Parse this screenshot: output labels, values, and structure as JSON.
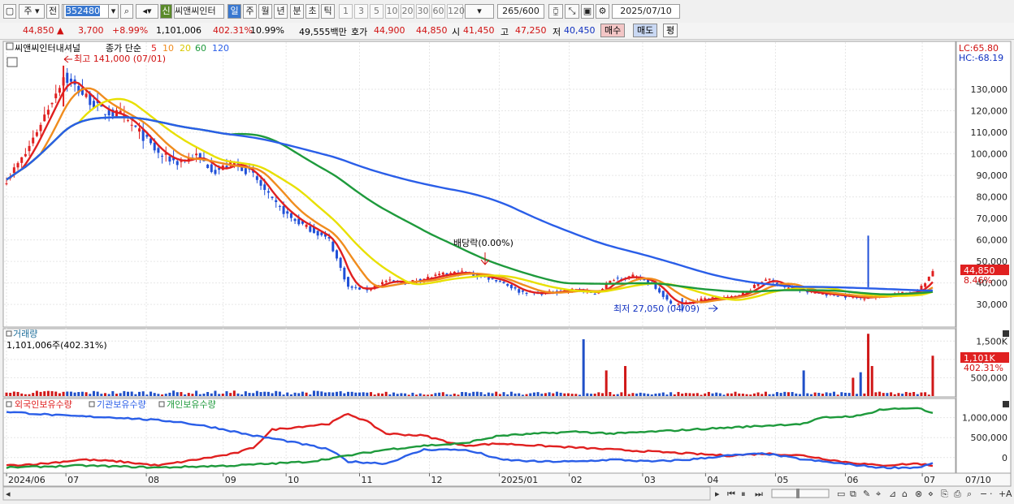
{
  "toolbar": {
    "market": "주",
    "market_type": "전",
    "code": "352480",
    "badge": "신",
    "stock_name": "씨앤씨인터",
    "periods": [
      "일",
      "주",
      "월",
      "년",
      "분",
      "초",
      "틱"
    ],
    "active_period": "일",
    "intervals": [
      "1",
      "3",
      "5",
      "10",
      "20",
      "30",
      "60",
      "120"
    ],
    "count": "265",
    "count_total": "/600",
    "date": "2025/07/10"
  },
  "info": {
    "price": "44,850",
    "change_arrow": "▲",
    "change": "3,700",
    "change_pct": "+8.99%",
    "volume": "1,101,006",
    "volume_ratio": "402.31%",
    "turnover": "10.99%",
    "amount": "49,555백만",
    "quote_label": "호가",
    "quote_ask": "44,900",
    "quote_bid": "44,850",
    "open_label": "시",
    "open": "41,450",
    "high_label": "고",
    "high": "47,250",
    "low_label": "저",
    "low": "40,450",
    "buy_label": "매수",
    "sell_label": "매도",
    "avg_label": "평"
  },
  "legend": {
    "stock": "씨앤씨인터내셔널",
    "price_type": "종가 단순",
    "ma": [
      {
        "period": "5",
        "color": "#e02020"
      },
      {
        "period": "10",
        "color": "#f08c1e"
      },
      {
        "period": "20",
        "color": "#e8e000"
      },
      {
        "period": "60",
        "color": "#1e9a3c"
      },
      {
        "period": "120",
        "color": "#2a5ee8"
      }
    ],
    "lc": "LC:65.80",
    "hc": "HC:-68.19",
    "max_label": "최고 141,000 (07/01)",
    "min_label": "최저 27,050 (04/09)",
    "dividend_label": "배당락(0.00%)",
    "current_price": "44,850",
    "current_pct": "8.46%"
  },
  "volume_panel": {
    "title": "거래량",
    "value": "1,101,006주(402.31%)",
    "current": "1,101K",
    "current_pct": "402.31%"
  },
  "holdings_panel": {
    "series": [
      {
        "name": "외국인보유수량",
        "color": "#e02020"
      },
      {
        "name": "기관보유수량",
        "color": "#2a5ee8"
      },
      {
        "name": "개인보유수량",
        "color": "#1e9a3c"
      }
    ]
  },
  "x_axis_labels": [
    "2024/06",
    "07",
    "08",
    "09",
    "10",
    "11",
    "12",
    "2025/01",
    "02",
    "03",
    "04",
    "05",
    "06",
    "07"
  ],
  "x_axis_end": "07/10",
  "chart_data": [
    {
      "type": "candlestick",
      "y_ticks": [
        30000,
        40000,
        50000,
        60000,
        70000,
        80000,
        90000,
        100000,
        110000,
        120000,
        130000
      ],
      "ylim": [
        21000,
        150000
      ],
      "close_keypoints": [
        [
          0,
          88000
        ],
        [
          5,
          100000
        ],
        [
          10,
          118000
        ],
        [
          15,
          136000
        ],
        [
          20,
          128000
        ],
        [
          25,
          120000
        ],
        [
          30,
          118000
        ],
        [
          35,
          110000
        ],
        [
          40,
          100000
        ],
        [
          45,
          96000
        ],
        [
          50,
          99000
        ],
        [
          55,
          92000
        ],
        [
          60,
          96000
        ],
        [
          65,
          90000
        ],
        [
          70,
          78000
        ],
        [
          75,
          70000
        ],
        [
          80,
          65000
        ],
        [
          85,
          60000
        ],
        [
          90,
          38000
        ],
        [
          95,
          37000
        ],
        [
          100,
          41000
        ],
        [
          105,
          40000
        ],
        [
          110,
          42000
        ],
        [
          115,
          44000
        ],
        [
          120,
          45000
        ],
        [
          125,
          43000
        ],
        [
          130,
          41000
        ],
        [
          135,
          36000
        ],
        [
          140,
          35000
        ],
        [
          145,
          36000
        ],
        [
          150,
          37000
        ],
        [
          155,
          35000
        ],
        [
          160,
          42000
        ],
        [
          165,
          43000
        ],
        [
          170,
          40000
        ],
        [
          175,
          30000
        ],
        [
          180,
          31000
        ],
        [
          185,
          33000
        ],
        [
          190,
          33000
        ],
        [
          195,
          36000
        ],
        [
          200,
          42000
        ],
        [
          205,
          38000
        ],
        [
          210,
          36000
        ],
        [
          215,
          35000
        ],
        [
          220,
          34000
        ],
        [
          225,
          33000
        ],
        [
          230,
          34000
        ],
        [
          235,
          35000
        ],
        [
          240,
          36000
        ],
        [
          244,
          44850
        ]
      ],
      "max": {
        "value": 141000,
        "label_date": "07/01"
      },
      "min": {
        "value": 27050,
        "label_date": "04/09"
      }
    },
    {
      "type": "bar",
      "name": "거래량",
      "y_ticks": [
        500000,
        1000000,
        1500000
      ],
      "ylim": [
        0,
        1750000
      ],
      "last_value": 1101006,
      "spikes": [
        [
          152,
          1550000
        ],
        [
          158,
          700000
        ],
        [
          163,
          820000
        ],
        [
          210,
          700000
        ],
        [
          223,
          500000
        ],
        [
          225,
          650000
        ],
        [
          227,
          1700000
        ],
        [
          228,
          820000
        ],
        [
          244,
          1101006
        ]
      ]
    },
    {
      "type": "line",
      "y_ticks": [
        0,
        500000,
        1000000
      ],
      "ylim": [
        -350000,
        1400000
      ],
      "series": [
        {
          "name": "외국인보유수량",
          "keypoints": [
            [
              0,
              -200000
            ],
            [
              10,
              -150000
            ],
            [
              20,
              -50000
            ],
            [
              30,
              -100000
            ],
            [
              40,
              -200000
            ],
            [
              50,
              -50000
            ],
            [
              60,
              100000
            ],
            [
              65,
              250000
            ],
            [
              70,
              700000
            ],
            [
              80,
              800000
            ],
            [
              85,
              850000
            ],
            [
              90,
              1100000
            ],
            [
              95,
              900000
            ],
            [
              100,
              600000
            ],
            [
              110,
              550000
            ],
            [
              120,
              300000
            ],
            [
              130,
              350000
            ],
            [
              140,
              300000
            ],
            [
              150,
              250000
            ],
            [
              160,
              200000
            ],
            [
              170,
              150000
            ],
            [
              180,
              100000
            ],
            [
              190,
              50000
            ],
            [
              200,
              100000
            ],
            [
              210,
              50000
            ],
            [
              220,
              -100000
            ],
            [
              230,
              -200000
            ],
            [
              240,
              -150000
            ],
            [
              244,
              -200000
            ]
          ]
        },
        {
          "name": "기관보유수량",
          "keypoints": [
            [
              0,
              1150000
            ],
            [
              15,
              1050000
            ],
            [
              30,
              1000000
            ],
            [
              45,
              900000
            ],
            [
              55,
              750000
            ],
            [
              65,
              550000
            ],
            [
              72,
              450000
            ],
            [
              80,
              300000
            ],
            [
              85,
              200000
            ],
            [
              90,
              -100000
            ],
            [
              100,
              -150000
            ],
            [
              110,
              200000
            ],
            [
              120,
              200000
            ],
            [
              125,
              100000
            ],
            [
              130,
              -50000
            ],
            [
              140,
              -100000
            ],
            [
              150,
              -100000
            ],
            [
              160,
              -50000
            ],
            [
              170,
              -100000
            ],
            [
              180,
              -50000
            ],
            [
              190,
              50000
            ],
            [
              200,
              100000
            ],
            [
              210,
              -50000
            ],
            [
              220,
              -150000
            ],
            [
              230,
              -250000
            ],
            [
              240,
              -250000
            ],
            [
              244,
              -150000
            ]
          ]
        },
        {
          "name": "개인보유수량",
          "keypoints": [
            [
              0,
              -250000
            ],
            [
              20,
              -200000
            ],
            [
              40,
              -250000
            ],
            [
              60,
              -200000
            ],
            [
              70,
              -150000
            ],
            [
              80,
              -100000
            ],
            [
              90,
              50000
            ],
            [
              100,
              200000
            ],
            [
              110,
              300000
            ],
            [
              120,
              350000
            ],
            [
              130,
              550000
            ],
            [
              140,
              600000
            ],
            [
              150,
              650000
            ],
            [
              160,
              600000
            ],
            [
              170,
              650000
            ],
            [
              180,
              700000
            ],
            [
              190,
              750000
            ],
            [
              200,
              800000
            ],
            [
              210,
              850000
            ],
            [
              215,
              1000000
            ],
            [
              225,
              1050000
            ],
            [
              230,
              1200000
            ],
            [
              240,
              1250000
            ],
            [
              244,
              1100000
            ]
          ]
        }
      ]
    }
  ]
}
